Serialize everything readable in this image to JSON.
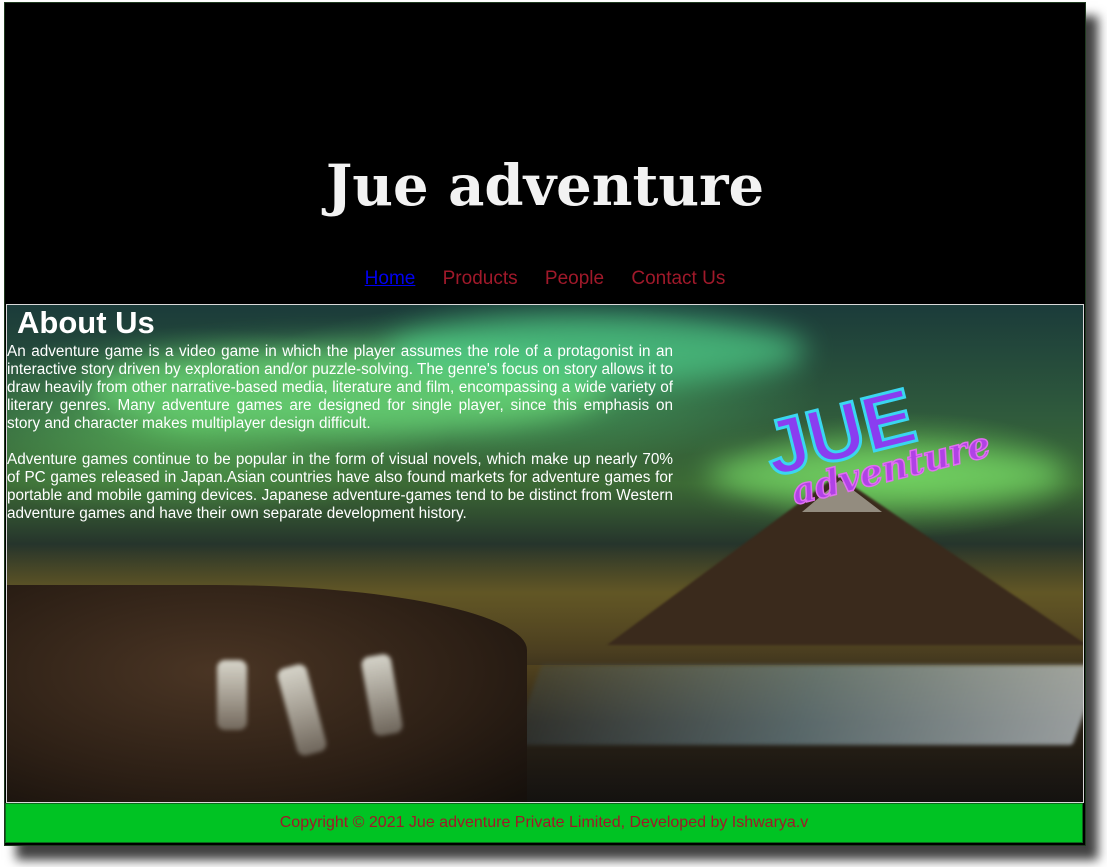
{
  "header": {
    "title": "Jue adventure"
  },
  "nav": {
    "items": [
      {
        "label": "Home",
        "active": true
      },
      {
        "label": "Products",
        "active": false
      },
      {
        "label": "People",
        "active": false
      },
      {
        "label": "Contact Us",
        "active": false
      }
    ]
  },
  "about": {
    "heading": "About Us",
    "paragraphs": [
      "An adventure game is a video game in which the player assumes the role of a protagonist in an interactive story driven by exploration and/or puzzle-solving. The genre's focus on story allows it to draw heavily from other narrative-based media, literature and film, encompassing a wide variety of literary genres. Many adventure games are designed for single player, since this emphasis on story and character makes multiplayer design difficult.",
      "Adventure games continue to be popular in the form of visual novels, which make up nearly 70% of PC games released in Japan.Asian countries have also found markets for adventure games for portable and mobile gaming devices. Japanese adventure-games tend to be distinct from Western adventure games and have their own separate development history."
    ]
  },
  "logo": {
    "line1": "JUE",
    "line2": "adventure"
  },
  "footer": {
    "text": "Copyright © 2021 Jue adventure Private Limited, Developed by Ishwarya.v"
  },
  "colors": {
    "header_bg": "#000000",
    "title": "#f2f2f2",
    "nav_link": "#a0192a",
    "nav_active": "#0000ee",
    "footer_bg": "#00c323",
    "footer_text": "#a0192a",
    "logo_fill": "#8a3df0",
    "logo_outline": "#3ad6f0"
  }
}
